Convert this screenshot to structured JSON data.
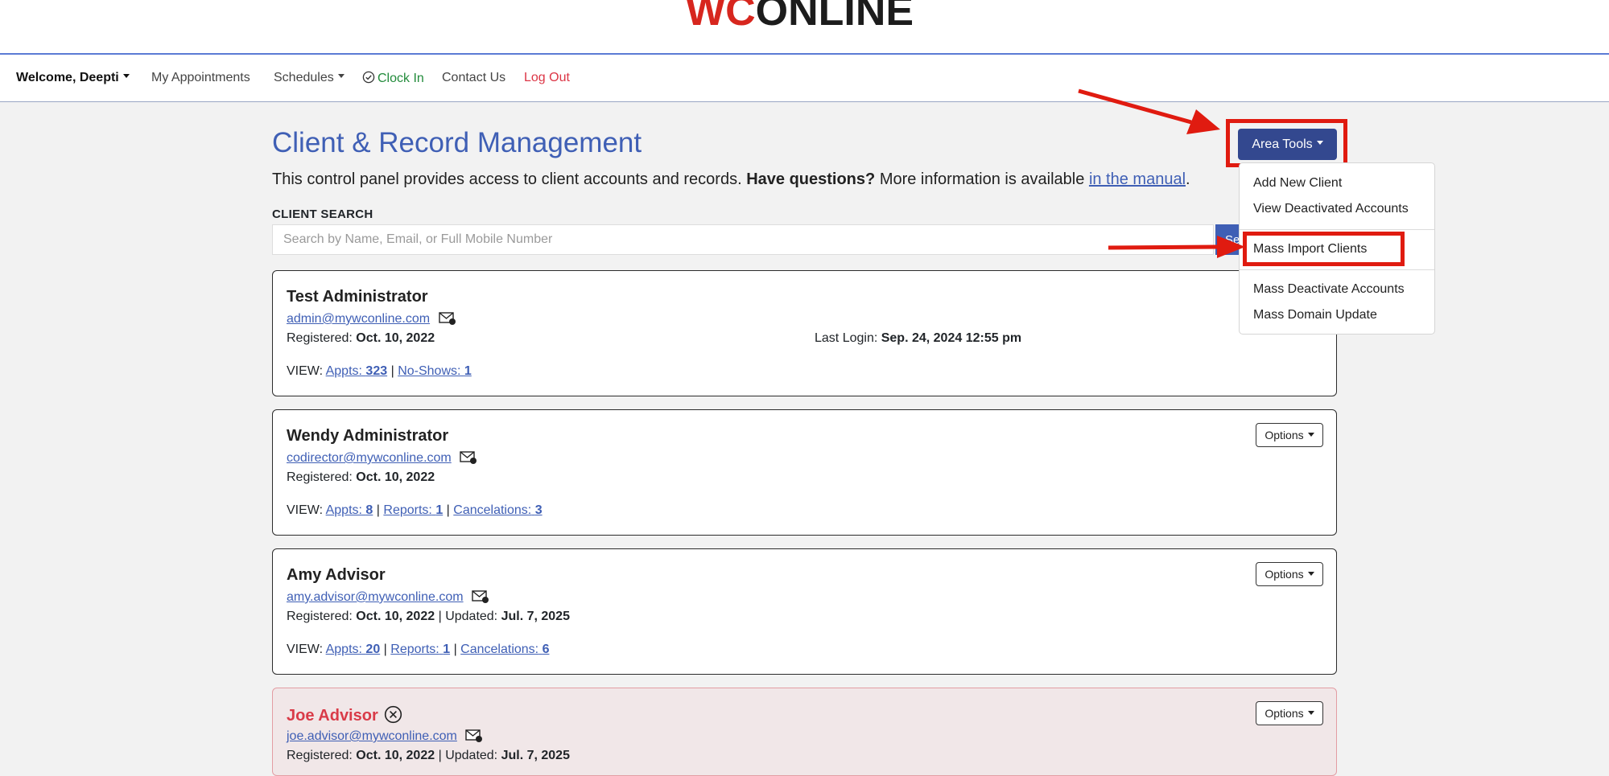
{
  "brand": {
    "logo_wc": "WC",
    "logo_online": "ONLINE"
  },
  "nav": {
    "welcome": "Welcome, Deepti",
    "appointments": "My Appointments",
    "schedules": "Schedules",
    "clock_in": "Clock In",
    "contact": "Contact Us",
    "logout": "Log Out"
  },
  "page": {
    "title": "Client & Record Management",
    "intro_text": "This control panel provides access to client accounts and records.",
    "intro_bold": "Have questions?",
    "intro_more": "More information is available",
    "intro_link": "in the manual",
    "intro_end": "."
  },
  "search": {
    "label": "CLIENT SEARCH",
    "placeholder": "Search by Name, Email, or Full Mobile Number",
    "value": "",
    "button": "Search"
  },
  "area_tools": {
    "label": "Area Tools",
    "items": [
      "Add New Client",
      "View Deactivated Accounts",
      "Mass Import Clients",
      "Mass Deactivate Accounts",
      "Mass Domain Update"
    ]
  },
  "common": {
    "registered_label": "Registered:",
    "updated_label": "Updated:",
    "last_login_label": "Last Login:",
    "view_label": "VIEW:",
    "sep": "|",
    "options": "Options"
  },
  "clients": [
    {
      "name": "Test Administrator",
      "email": "admin@mywconline.com",
      "registered": "Oct. 10, 2022",
      "last_login": "Sep. 24, 2024 12:55 pm",
      "appts_label": "Appts:",
      "appts": "323",
      "noshows_label": "No-Shows:",
      "noshows": "1"
    },
    {
      "name": "Wendy Administrator",
      "email": "codirector@mywconline.com",
      "registered": "Oct. 10, 2022",
      "appts_label": "Appts:",
      "appts": "8",
      "reports_label": "Reports:",
      "reports": "1",
      "cancel_label": "Cancelations:",
      "cancels": "3"
    },
    {
      "name": "Amy Advisor",
      "email": "amy.advisor@mywconline.com",
      "registered": "Oct. 10, 2022",
      "updated": "Jul. 7, 2025",
      "appts_label": "Appts:",
      "appts": "20",
      "reports_label": "Reports:",
      "reports": "1",
      "cancel_label": "Cancelations:",
      "cancels": "6"
    },
    {
      "name": "Joe Advisor",
      "email": "joe.advisor@mywconline.com",
      "registered": "Oct. 10, 2022",
      "updated": "Jul. 7, 2025"
    }
  ]
}
